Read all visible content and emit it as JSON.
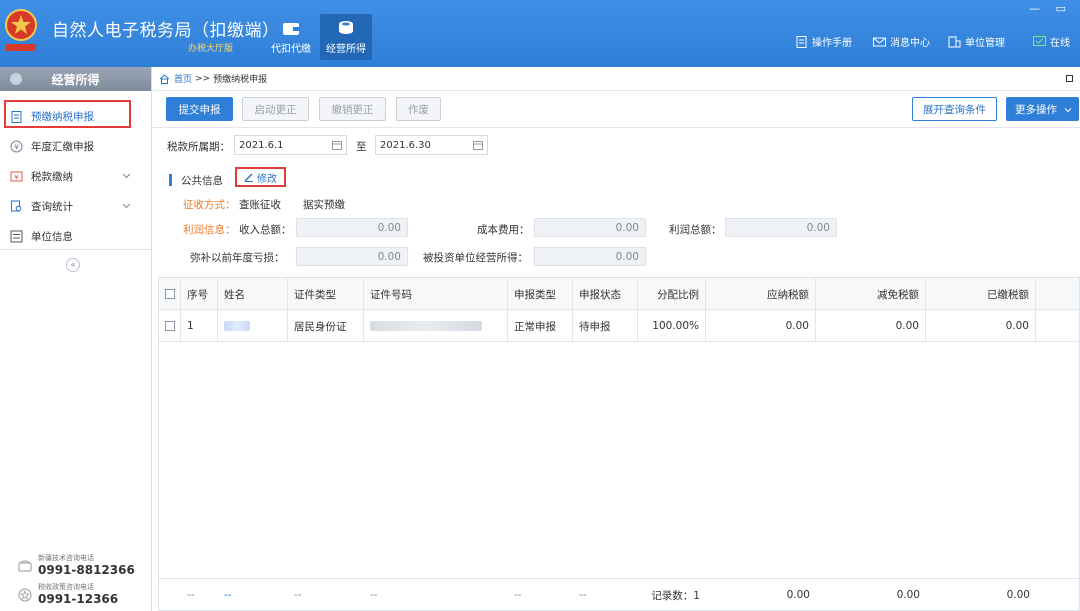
{
  "app": {
    "title": "自然人电子税务局（扣缴端）",
    "subtitle": "办税大厅版",
    "modules": [
      {
        "label": "代扣代缴"
      },
      {
        "label": "经营所得"
      }
    ],
    "top_links": {
      "manual": "操作手册",
      "messages": "消息中心",
      "unit_mgmt": "单位管理",
      "online": "在线"
    },
    "colors": {
      "primary": "#2f7fd8",
      "highlight": "#e23b3b",
      "orange": "#f07b2a"
    }
  },
  "sidebar": {
    "header": "经营所得",
    "items": [
      {
        "label": "预缴纳税申报"
      },
      {
        "label": "年度汇缴申报"
      },
      {
        "label": "税款缴纳"
      },
      {
        "label": "查询统计"
      },
      {
        "label": "单位信息"
      }
    ],
    "collapse_icon": "«",
    "hotlines": [
      {
        "label": "新疆技术咨询电话",
        "number": "0991-8812366"
      },
      {
        "label": "税收政策咨询电话",
        "number": "0991-12366"
      }
    ]
  },
  "breadcrumb": {
    "home": "首页",
    "sep": ">>",
    "current": "预缴纳税申报"
  },
  "toolbar": {
    "submit": "提交申报",
    "start_correction": "启动更正",
    "cancel_correction": "撤销更正",
    "void": "作废",
    "expand_query": "展开查询条件",
    "more_ops": "更多操作"
  },
  "period": {
    "label": "税款所属期：",
    "start": "2021.6.1",
    "to": "至",
    "end": "2021.6.30"
  },
  "public_info": {
    "title": "公共信息",
    "edit": "修改",
    "collection_label": "征收方式：",
    "collection_value": "查账征收",
    "prepay_mode": "据实预缴",
    "profit_label": "利润信息：",
    "income_label": "收入总额：",
    "income_value": "0.00",
    "cost_label": "成本费用：",
    "cost_value": "0.00",
    "profit_total_label": "利润总额：",
    "profit_total_value": "0.00",
    "loss_label": "弥补以前年度亏损：",
    "loss_value": "0.00",
    "invested_label": "被投资单位经营所得：",
    "invested_value": "0.00"
  },
  "table": {
    "headers": [
      "序号",
      "姓名",
      "证件类型",
      "证件号码",
      "申报类型",
      "申报状态",
      "分配比例",
      "应纳税额",
      "减免税额",
      "已缴税额"
    ],
    "rows": [
      {
        "seq": "1",
        "id_type": "居民身份证",
        "decl_type": "正常申报",
        "status": "待申报",
        "ratio": "100.00%",
        "tax_due": "0.00",
        "tax_relief": "0.00",
        "tax_paid": "0.00"
      }
    ],
    "footer": {
      "dash": "--",
      "count": "记录数：1",
      "tax_due": "0.00",
      "tax_relief": "0.00",
      "tax_paid": "0.00"
    }
  }
}
